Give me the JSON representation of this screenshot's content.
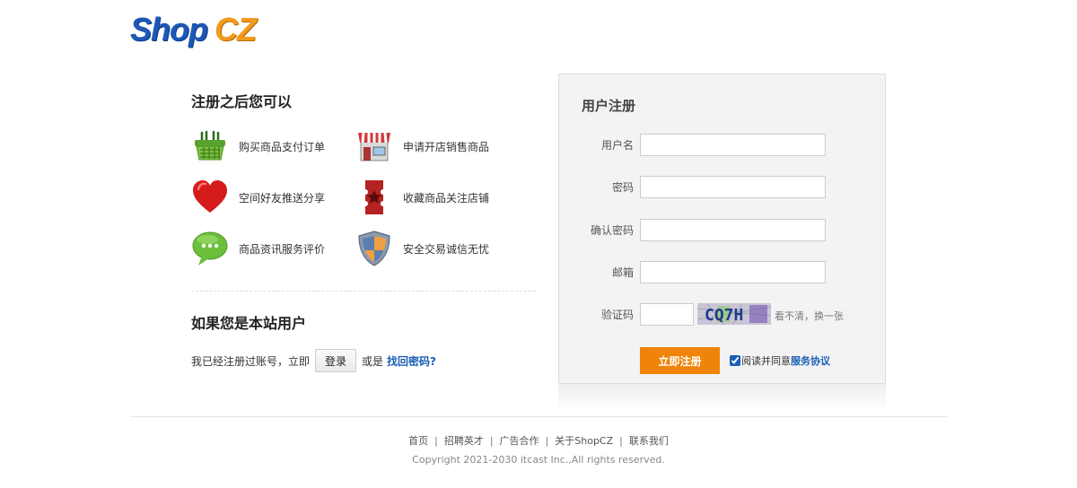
{
  "brand": {
    "part1": "Shop",
    "part2": "CZ"
  },
  "benefits": {
    "title": "注册之后您可以",
    "items": [
      {
        "icon": "basket-icon",
        "label": "购买商品支付订单"
      },
      {
        "icon": "storefront-icon",
        "label": "申请开店销售商品"
      },
      {
        "icon": "heart-icon",
        "label": "空间好友推送分享"
      },
      {
        "icon": "bookmark-ribbon-icon",
        "label": "收藏商品关注店铺"
      },
      {
        "icon": "chat-bubble-icon",
        "label": "商品资讯服务评价"
      },
      {
        "icon": "shield-icon",
        "label": "安全交易诚信无忧"
      }
    ]
  },
  "existing_user": {
    "title": "如果您是本站用户",
    "prefix": "我已经注册过账号，立即",
    "login_label": "登录",
    "middle": "或是",
    "find_password": "找回密码?"
  },
  "register": {
    "title": "用户注册",
    "fields": {
      "username": {
        "label": "用户名",
        "value": ""
      },
      "password": {
        "label": "密码",
        "value": ""
      },
      "confirm": {
        "label": "确认密码",
        "value": ""
      },
      "email": {
        "label": "邮箱",
        "value": ""
      },
      "code": {
        "label": "验证码",
        "value": ""
      }
    },
    "captcha_text": "CQ7H",
    "refresh_text": "看不清，换一张",
    "submit_label": "立即注册",
    "agree_text": "阅读并同意",
    "agree_link": "服务协议",
    "agree_checked": true
  },
  "footer": {
    "links": [
      "首页",
      "招聘英才",
      "广告合作",
      "关于ShopCZ",
      "联系我们"
    ],
    "copyright": "Copyright 2021-2030 itcast Inc.,All rights reserved."
  },
  "colors": {
    "brand_blue": "#1d58b8",
    "brand_orange": "#f39a1d",
    "button_orange": "#f0830a",
    "link_blue": "#1a5fb4"
  }
}
